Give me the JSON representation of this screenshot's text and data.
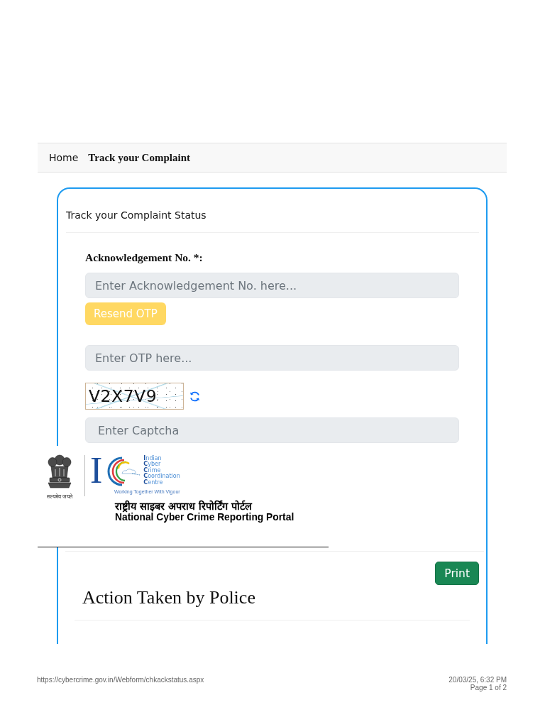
{
  "nav": {
    "items": [
      {
        "label": "Home",
        "selected": false
      },
      {
        "label": "Track your Complaint",
        "selected": true
      }
    ]
  },
  "card": {
    "title": "Track your Complaint Status",
    "form": {
      "label": "Acknowledgement No. *:",
      "acknowledgement_field": {
        "placeholder": "Enter Acknowledgement No. here..."
      },
      "resend_button": "Resend OTP",
      "otp_field": {
        "placeholder": "Enter OTP here..."
      },
      "captcha": {
        "text": "V2X7V9"
      },
      "captcha_field": {
        "placeholder": "Enter Captcha"
      }
    },
    "print_button": "Print",
    "section_title": "Action Taken by Police"
  },
  "logo_banner": {
    "emblem_motto": "सत्यमेव जयते",
    "logo_letter": "I",
    "centre_name": [
      "**I**ndian",
      "**C**yber",
      "**C**rime",
      "**C**oordination",
      "**C**entre"
    ],
    "tagline": "Working Together With Vigour",
    "portal_hindi": "राष्ट्रीय साइबर अपराध रिपोर्टिंग पोर्टल",
    "portal_english": "National Cyber Crime Reporting Portal"
  },
  "footer": {
    "url": "https://cybercrime.gov.in/Webform/chkackstatus.aspx",
    "datetime": "20/03/25, 6:32 PM",
    "page": "Page 1 of 2"
  }
}
